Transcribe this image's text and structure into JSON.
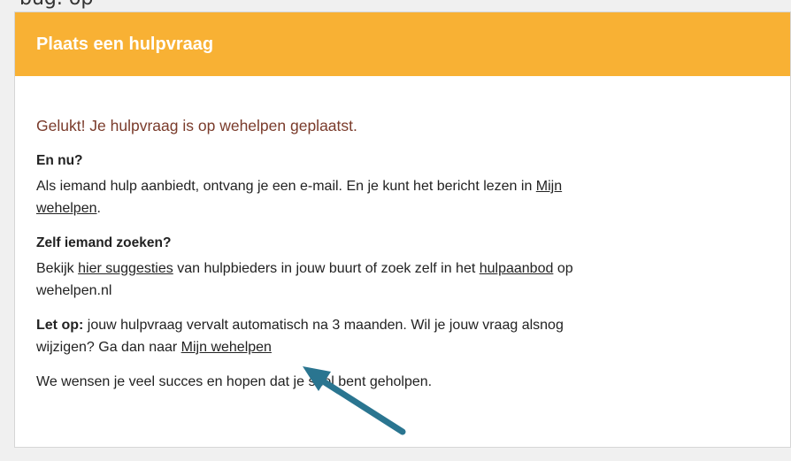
{
  "top_cut_text": "bug. op",
  "card": {
    "title": "Plaats een hulpvraag",
    "success": "Gelukt! Je hulpvraag is op wehelpen geplaatst.",
    "section1": {
      "heading": "En nu?",
      "text_before": "Als iemand hulp aanbiedt, ontvang je een e-mail. En je kunt het bericht lezen in ",
      "link": "Mijn wehelpen",
      "text_after": "."
    },
    "section2": {
      "heading": "Zelf iemand zoeken?",
      "text1": "Bekijk ",
      "link1": "hier suggesties",
      "text2": " van hulpbieders in jouw buurt of zoek zelf in het ",
      "link2": "hulpaanbod",
      "text3": " op wehelpen.nl"
    },
    "notice": {
      "bold": "Let op:",
      "text": " jouw hulpvraag vervalt automatisch na 3 maanden. Wil je jouw vraag alsnog wijzigen? Ga dan naar ",
      "link": "Mijn wehelpen"
    },
    "closing": "We wensen je veel succes en hopen dat je snel bent geholpen."
  },
  "colors": {
    "header": "#f8b134",
    "success_text": "#7a3b2b",
    "arrow": "#2a7590"
  }
}
